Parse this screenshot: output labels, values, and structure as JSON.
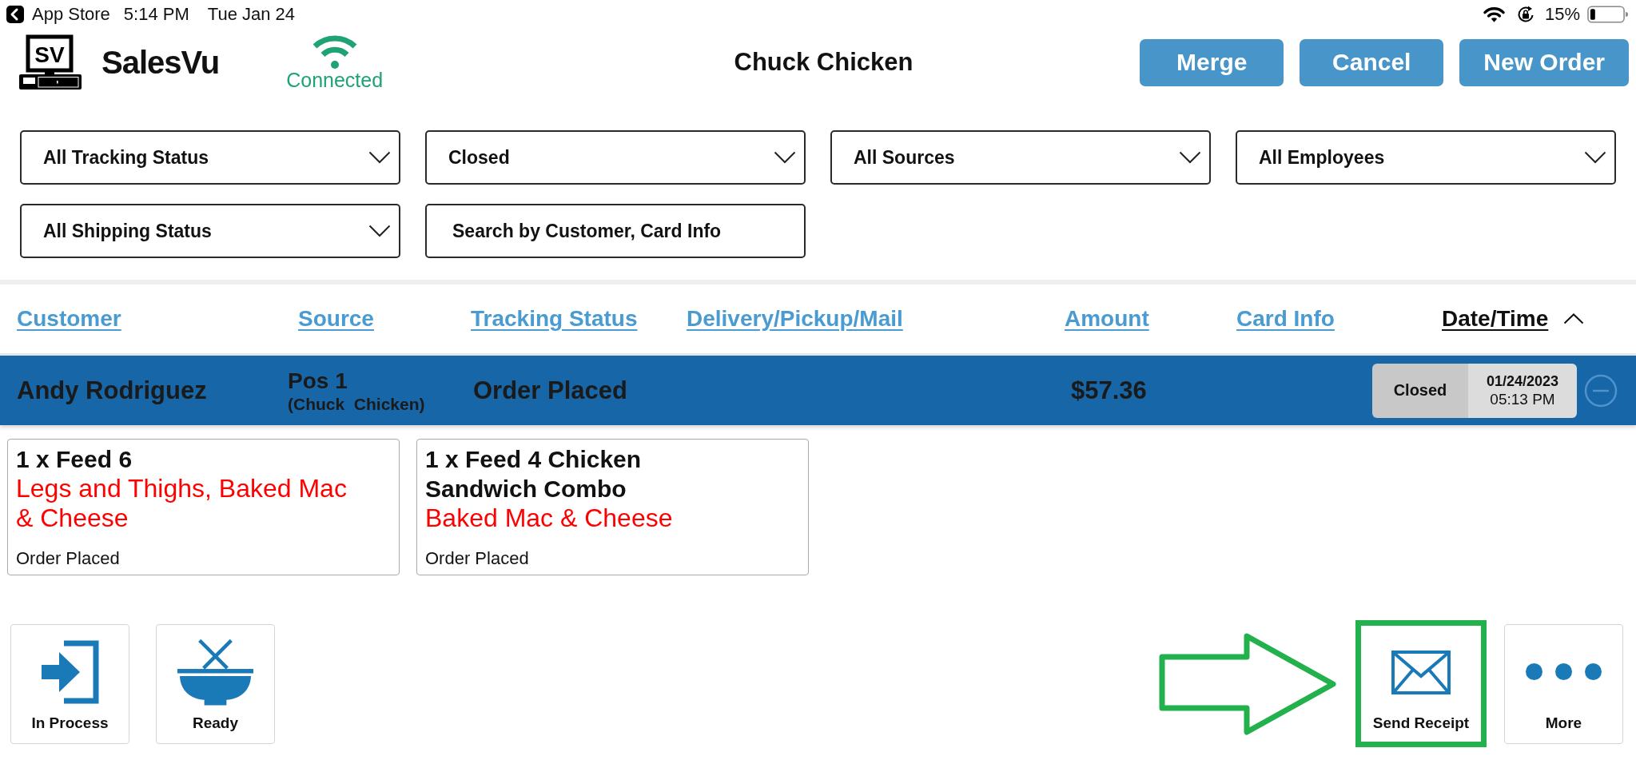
{
  "status_bar": {
    "back_label": "App Store",
    "time": "5:14 PM",
    "date": "Tue Jan 24",
    "battery": "15%"
  },
  "header": {
    "logo_mark": "SV",
    "app_name": "SalesVu",
    "connection": "Connected",
    "title": "Chuck Chicken",
    "buttons": [
      "Merge",
      "Cancel",
      "New Order"
    ]
  },
  "filters": [
    {
      "kind": "dropdown",
      "value": "All Tracking Status"
    },
    {
      "kind": "dropdown",
      "value": "Closed"
    },
    {
      "kind": "dropdown",
      "value": "All Sources"
    },
    {
      "kind": "dropdown",
      "value": "All Employees"
    },
    {
      "kind": "dropdown",
      "value": "All Shipping Status"
    },
    {
      "kind": "search",
      "placeholder": "Search by Customer, Card Info"
    }
  ],
  "table": {
    "columns": [
      {
        "label": "Customer",
        "sorted": false
      },
      {
        "label": "Source",
        "sorted": false
      },
      {
        "label": "Tracking Status",
        "sorted": false
      },
      {
        "label": "Delivery/Pickup/Mail",
        "sorted": false
      },
      {
        "label": "Amount",
        "sorted": false
      },
      {
        "label": "Card Info",
        "sorted": false
      },
      {
        "label": "Date/Time",
        "sorted": true
      }
    ],
    "rows": [
      {
        "selected": true,
        "expanded": true,
        "customer": "Andy Rodriguez",
        "source": "Pos 1",
        "source_detail": "(Chuck  Chicken)",
        "tracking_status": "Order Placed",
        "amount": "$57.36",
        "status": "Closed",
        "date": "01/24/2023",
        "time": "05:13 PM",
        "items": [
          {
            "name": "1 x Feed 6",
            "modifiers": "Legs and Thighs, Baked Mac & Cheese",
            "status": "Order Placed"
          },
          {
            "name": "1 x Feed 4 Chicken Sandwich Combo",
            "modifiers": "Baked Mac & Cheese",
            "status": "Order Placed"
          }
        ]
      }
    ]
  },
  "actions": {
    "left": [
      {
        "kind": "enter",
        "label": "In Process",
        "highlighted": false
      },
      {
        "kind": "bowl",
        "label": "Ready",
        "highlighted": false
      }
    ],
    "right": [
      {
        "kind": "envelope",
        "label": "Send Receipt",
        "highlighted": true
      },
      {
        "kind": "dots",
        "label": "More",
        "highlighted": false
      }
    ]
  }
}
